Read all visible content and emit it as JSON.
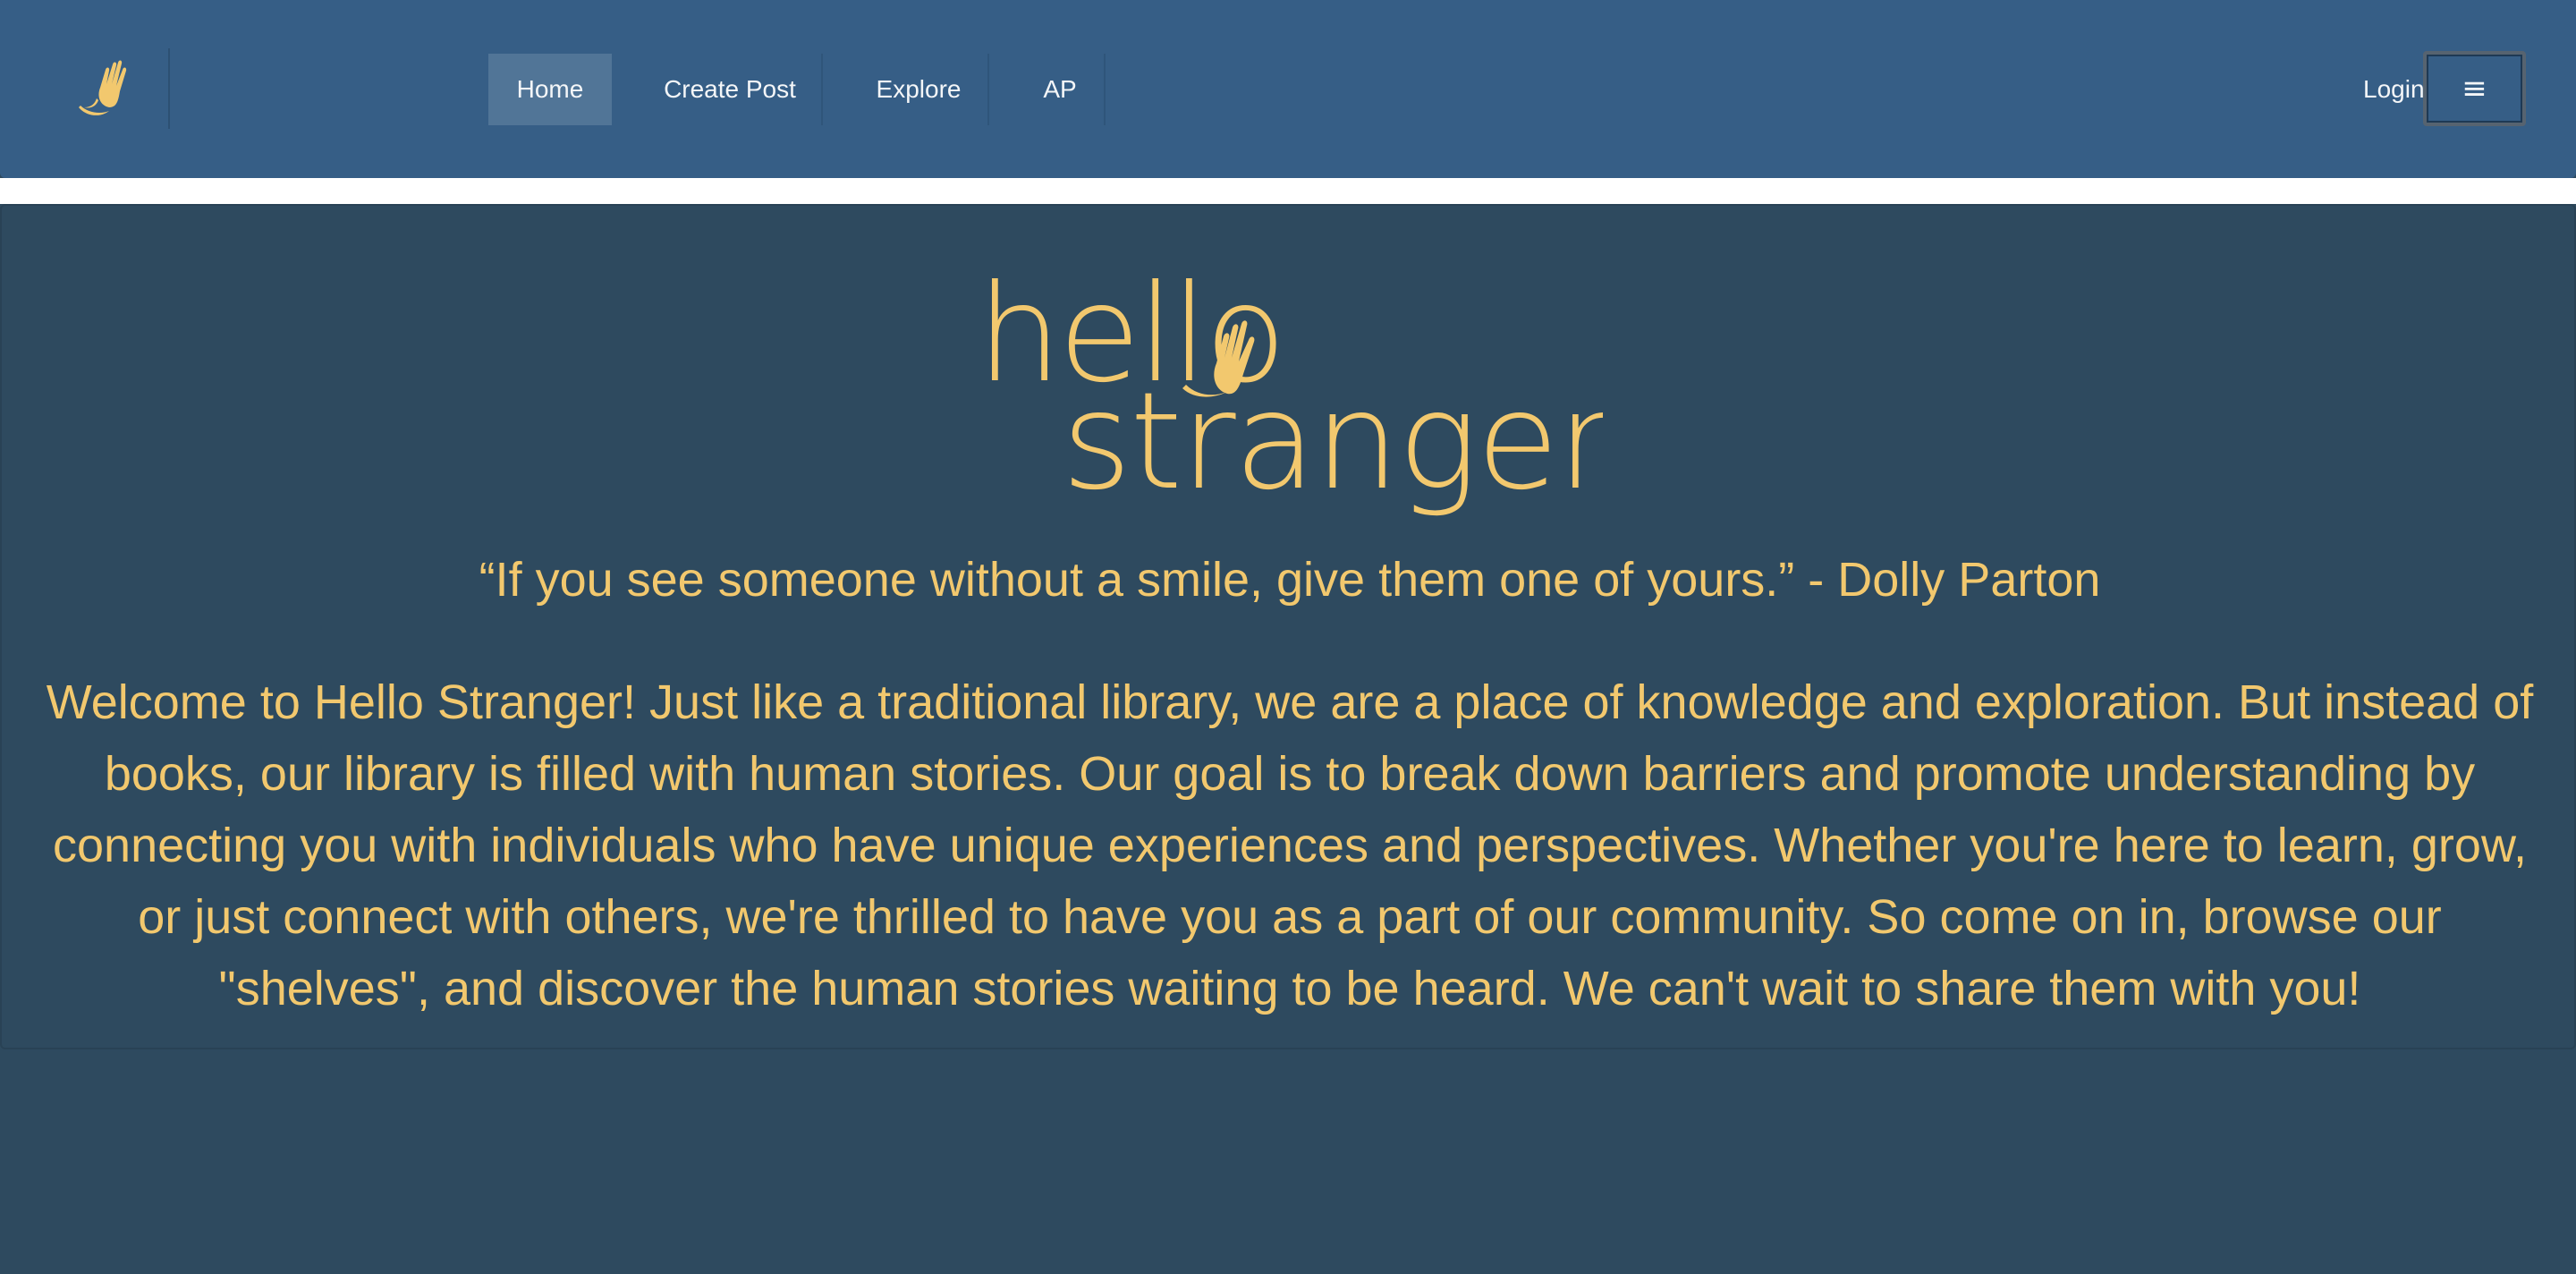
{
  "nav": {
    "items": [
      {
        "label": "Home",
        "active": true
      },
      {
        "label": "Create Post",
        "active": false
      },
      {
        "label": "Explore",
        "active": false
      },
      {
        "label": "AP",
        "active": false
      }
    ],
    "login_label": "Login",
    "menu_icon": "≡",
    "brand_icon": "waving-hand-logo"
  },
  "hero": {
    "logo_word_1": "hello",
    "logo_word_2": "stranger",
    "quote": "“If you see someone without a smile, give them one of yours.” - Dolly Parton",
    "welcome": "Welcome to Hello Stranger! Just like a traditional library, we are a place of knowledge and exploration. But instead of books, our library is filled with human stories. Our goal is to break down barriers and promote understanding by connecting you with individuals who have unique experiences and perspectives. Whether you're here to learn, grow, or just connect with others, we're thrilled to have you as a part of our community. So come on in, browse our \"shelves\", and discover the human stories waiting to be heard. We can't wait to share them with you!"
  },
  "colors": {
    "navbar": "#365e86",
    "background": "#2e4a5f",
    "accent": "#f2c86e",
    "active_nav": "#517597"
  }
}
